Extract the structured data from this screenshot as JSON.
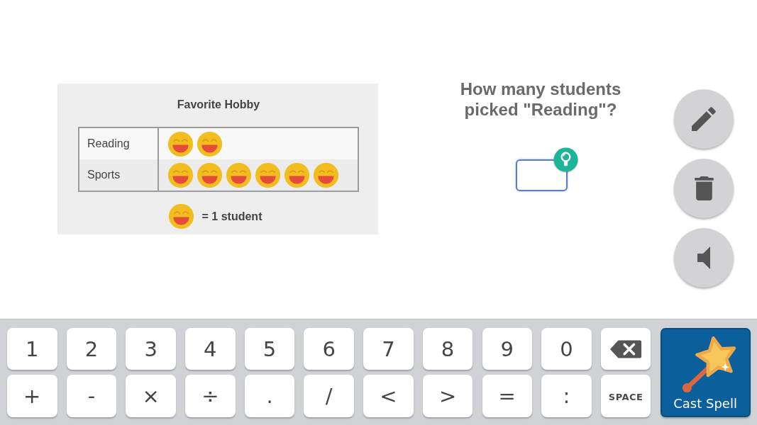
{
  "pictograph": {
    "title": "Favorite Hobby",
    "rows": [
      {
        "label": "Reading",
        "icons": [
          {
            "kind": "smiley"
          },
          {
            "kind": "smiley"
          }
        ]
      },
      {
        "label": "Sports",
        "icons": [
          {
            "kind": "smiley"
          },
          {
            "kind": "smiley"
          },
          {
            "kind": "smiley"
          },
          {
            "kind": "smiley"
          },
          {
            "kind": "smiley"
          },
          {
            "kind": "smiley"
          }
        ]
      }
    ],
    "key": {
      "kind": "smiley",
      "label": "= 1 student"
    }
  },
  "question": {
    "text": "How many students picked \"Reading\"?",
    "answer_box": {
      "focused": true
    },
    "hint": {
      "kind": "lightbulb"
    }
  },
  "tools": [
    {
      "kind": "pencil"
    },
    {
      "kind": "trash"
    },
    {
      "kind": "speaker"
    }
  ],
  "keyboard": {
    "rows": [
      [
        {
          "kind": "char",
          "label": "1"
        },
        {
          "kind": "char",
          "label": "2"
        },
        {
          "kind": "char",
          "label": "3"
        },
        {
          "kind": "char",
          "label": "4"
        },
        {
          "kind": "char",
          "label": "5"
        },
        {
          "kind": "char",
          "label": "6"
        },
        {
          "kind": "char",
          "label": "7"
        },
        {
          "kind": "char",
          "label": "8"
        },
        {
          "kind": "char",
          "label": "9"
        },
        {
          "kind": "char",
          "label": "0"
        },
        {
          "kind": "backspace"
        }
      ],
      [
        {
          "kind": "char",
          "label": "+"
        },
        {
          "kind": "char",
          "label": "-"
        },
        {
          "kind": "char",
          "label": "×"
        },
        {
          "kind": "char",
          "label": "÷"
        },
        {
          "kind": "char",
          "label": "."
        },
        {
          "kind": "char",
          "label": "/"
        },
        {
          "kind": "char",
          "label": "<"
        },
        {
          "kind": "char",
          "label": ">"
        },
        {
          "kind": "char",
          "label": "="
        },
        {
          "kind": "char",
          "label": ":"
        },
        {
          "kind": "word",
          "label": "SPACE"
        }
      ]
    ],
    "cast_button": {
      "label": "Cast Spell"
    }
  }
}
